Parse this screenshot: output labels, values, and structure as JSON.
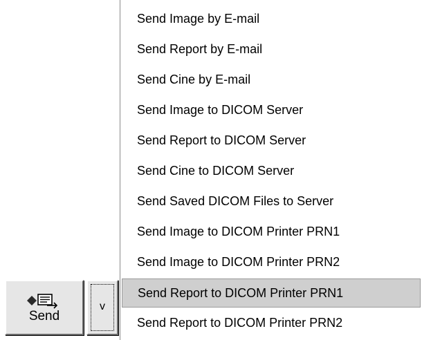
{
  "send_button": {
    "label": "Send",
    "icon": "send-envelope-icon"
  },
  "dropdown_button": {
    "label": "v"
  },
  "menu": {
    "highlighted_index": 9,
    "items": [
      {
        "label": "Send Image by E-mail"
      },
      {
        "label": "Send Report by E-mail"
      },
      {
        "label": "Send Cine by E-mail"
      },
      {
        "label": "Send Image to DICOM Server"
      },
      {
        "label": "Send Report to DICOM Server"
      },
      {
        "label": "Send Cine to DICOM Server"
      },
      {
        "label": "Send Saved DICOM Files to Server"
      },
      {
        "label": "Send Image to DICOM Printer PRN1"
      },
      {
        "label": "Send Image to DICOM Printer PRN2"
      },
      {
        "label": "Send Report to DICOM Printer PRN1"
      },
      {
        "label": "Send Report to DICOM Printer PRN2"
      }
    ]
  },
  "colors": {
    "button_face": "#e6e6e6",
    "menu_background": "#ffffff",
    "highlight": "#cfcfcf"
  }
}
